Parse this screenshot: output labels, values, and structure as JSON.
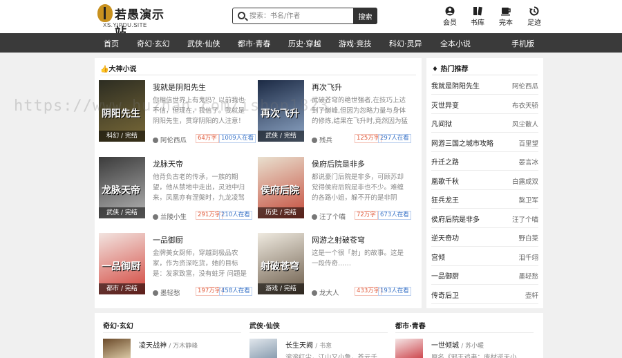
{
  "header": {
    "logo_text": "若愚演示站",
    "logo_sub": "XS.YIPDU.SITE",
    "search_placeholder": "搜索：书名/作者",
    "search_button": "搜索",
    "tools": [
      "会员",
      "书库",
      "完本",
      "足迹"
    ]
  },
  "nav": [
    "首页",
    "奇幻·玄幻",
    "武侠·仙侠",
    "都市·青春",
    "历史·穿越",
    "游戏·竞技",
    "科幻·灵异",
    "全本小说",
    "手机版"
  ],
  "featured": {
    "title": "大神小说",
    "books": [
      {
        "title": "我就是阴阳先生",
        "desc": "你相信世界上有鬼吗？以前我也不信，但现在，我信了。我就是阴阳先生，贯穿阴阳的人注意！书中……",
        "author": "阿伦西瓜",
        "words": "64万字",
        "reads": "1009人在看",
        "tag": "科幻 / 完结",
        "cover_text": "阴阳先生",
        "colors": [
          "#2d2d22",
          "#7a6a38"
        ]
      },
      {
        "title": "再次飞升",
        "desc": "武破苍穹的绝世强者,在技巧上达到了巅峰,但因为忽略力量与身体的修炼,结果在飞升时,竟然因为猛烈的……",
        "author": "残兵",
        "words": "125万字",
        "reads": "297人在看",
        "tag": "武侠 / 完结",
        "cover_text": "再次飞升",
        "colors": [
          "#1c2a44",
          "#8fa7c7"
        ]
      },
      {
        "title": "龙脉天帝",
        "desc": "他背负古老的传承，一族的期望，他从禁地中走出，灵池中归来，凤凰亦有涅槃时，九龙凌驾没有陨……",
        "author": "兰陵小生",
        "words": "291万字",
        "reads": "210人在看",
        "tag": "武侠 / 完结",
        "cover_text": "龙脉天帝",
        "colors": [
          "#3b3b3b",
          "#b5b5b5"
        ]
      },
      {
        "title": "侯府后院是非多",
        "desc": "都说豪门后院是非多，可顾苏却觉得侯府后院是非也不少。难缠的各路小姐，躲不开的是非阴谋，想……",
        "author": "汪了个喵",
        "words": "72万字",
        "reads": "673人在看",
        "tag": "历史 / 完结",
        "cover_text": "侯府后院",
        "colors": [
          "#e9e0cf",
          "#c44a3a"
        ]
      },
      {
        "title": "一品御厨",
        "desc": "金牌美女厨师，穿越到极品农家，作为资深吃货，她的目标是：发家致富，没有蛀牙 问题是身边有许……",
        "author": "墨轻愁",
        "words": "197万字",
        "reads": "458人在看",
        "tag": "都市 / 完结",
        "cover_text": "一品御厨",
        "colors": [
          "#f2e4e0",
          "#d2433a"
        ]
      },
      {
        "title": "网游之射破苍穹",
        "desc": "这是一个很「射」的故事。这是一段传奇……",
        "author": "龙大人",
        "words": "433万字",
        "reads": "193人在看",
        "tag": "游戏 / 完结",
        "cover_text": "射破苍穹",
        "colors": [
          "#efeae0",
          "#6a5a48"
        ]
      }
    ]
  },
  "hot": {
    "title": "热门推荐",
    "items": [
      {
        "title": "我就是阴阳先生",
        "author": "阿伦西瓜"
      },
      {
        "title": "灭世异变",
        "author": "布衣天骄"
      },
      {
        "title": "凡间狱",
        "author": "风尘散人"
      },
      {
        "title": "网游三国之城市攻略",
        "author": "百里望"
      },
      {
        "title": "升迁之路",
        "author": "晏言冰"
      },
      {
        "title": "凰歌千秋",
        "author": "白露成双"
      },
      {
        "title": "狂兵龙王",
        "author": "獒卫军"
      },
      {
        "title": "侯府后院是非多",
        "author": "汪了个喵"
      },
      {
        "title": "逆天奇功",
        "author": "野白菜"
      },
      {
        "title": "宫倾",
        "author": "泪千翊"
      },
      {
        "title": "一品御厨",
        "author": "墨轻愁"
      },
      {
        "title": "传奇后卫",
        "author": "壶轩"
      }
    ]
  },
  "categories": [
    {
      "name": "奇幻·玄幻",
      "book_title": "凌天战神",
      "book_author": "/ 万木静峰",
      "desc": "",
      "cover_text": "凌天",
      "colors": [
        "#6b4a2a",
        "#e8d9b5"
      ]
    },
    {
      "name": "武侠·仙侠",
      "book_title": "长生天阙",
      "book_author": "/ 书意",
      "desc": "滚滚红尘，江山又小鲁，苍元千……",
      "cover_text": "长生",
      "colors": [
        "#e0e6ec",
        "#7f94a8"
      ]
    },
    {
      "name": "都市·青春",
      "book_title": "一世倾城",
      "book_author": "/ 苏小暖",
      "desc": "原名《邪王追妻：废材逆天小……",
      "cover_text": "一世",
      "colors": [
        "#f5e6e6",
        "#c8323a"
      ]
    }
  ],
  "watermark": "https://www.huzhan.com/ishop1823"
}
